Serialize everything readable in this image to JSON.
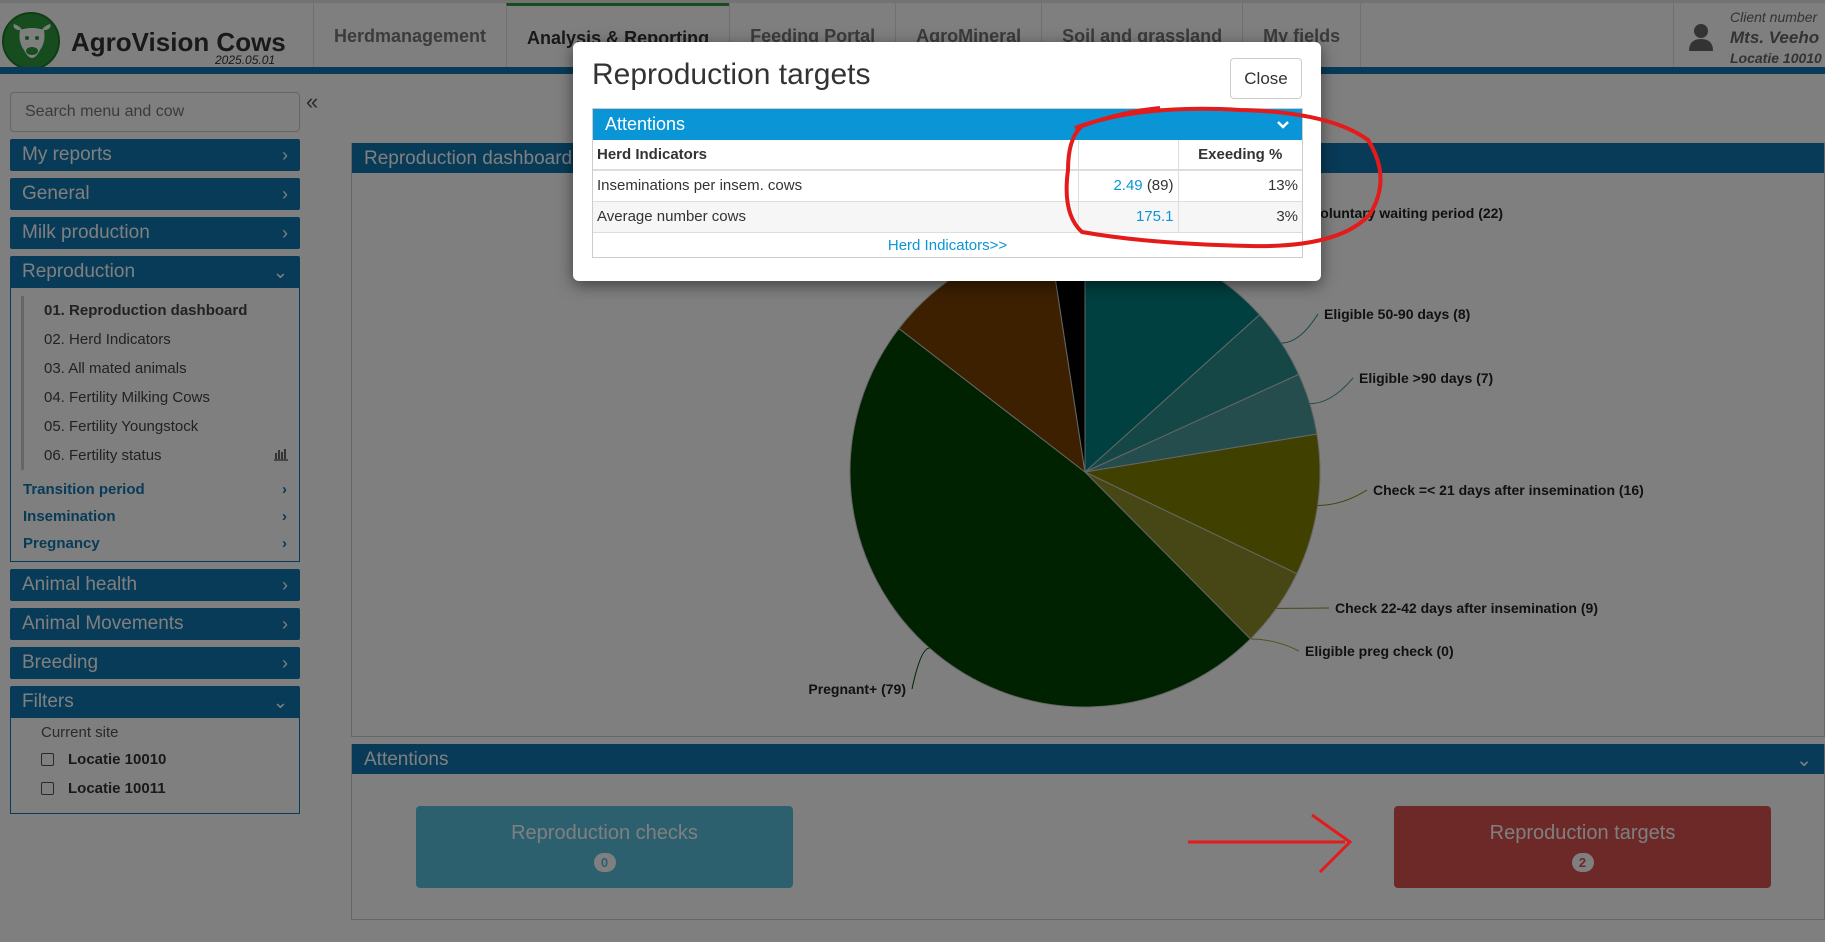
{
  "app": {
    "name": "AgroVision Cows",
    "version": "2025.05.01"
  },
  "nav": {
    "tabs": [
      {
        "label": "Herdmanagement",
        "active": false
      },
      {
        "label": "Analysis & Reporting",
        "active": true
      },
      {
        "label": "Feeding Portal",
        "active": false
      },
      {
        "label": "AgroMineral",
        "active": false
      },
      {
        "label": "Soil and grassland",
        "active": false
      },
      {
        "label": "My fields",
        "active": false
      }
    ]
  },
  "user": {
    "client_label": "Client number",
    "name": "Mts. Veeho",
    "location": "Locatie 10010"
  },
  "sidebar": {
    "search_placeholder": "Search menu and cow",
    "sections": {
      "my_reports": "My reports",
      "general": "General",
      "milk_production": "Milk production",
      "reproduction": "Reproduction",
      "animal_health": "Animal health",
      "animal_movements": "Animal Movements",
      "breeding": "Breeding",
      "filters": "Filters"
    },
    "reproduction_items": [
      "01. Reproduction dashboard",
      "02. Herd Indicators",
      "03. All mated animals",
      "04. Fertility Milking Cows",
      "05. Fertility Youngstock",
      "06. Fertility status"
    ],
    "reproduction_groups": [
      "Transition period",
      "Insemination",
      "Pregnancy"
    ],
    "filters": {
      "label": "Current site",
      "options": [
        "Locatie 10010",
        "Locatie 10011"
      ]
    }
  },
  "dashboard": {
    "title": "Reproduction dashboard"
  },
  "chart_data": {
    "type": "pie",
    "slices": [
      {
        "label": "Voluntary waiting period (22)",
        "value": 22,
        "color": "#008080"
      },
      {
        "label": "Eligible 50-90 days (8)",
        "value": 8,
        "color": "#2b8f8f"
      },
      {
        "label": "Eligible >90 days (7)",
        "value": 7,
        "color": "#4d9a9a"
      },
      {
        "label": "Check =< 21 days after insemination (16)",
        "value": 16,
        "color": "#808000"
      },
      {
        "label": "Check 22-42 days after insemination (9)",
        "value": 9,
        "color": "#8f8f2c"
      },
      {
        "label": "Eligible preg check (0)",
        "value": 0,
        "color": "#a6a640"
      },
      {
        "label": "Pregnant+ (79)",
        "value": 79,
        "color": "#004400"
      },
      {
        "label": "",
        "value": 20,
        "color": "#7a4000"
      },
      {
        "label": "",
        "value": 4,
        "color": "#000000"
      }
    ]
  },
  "attentions": {
    "title": "Attentions",
    "buttons": [
      {
        "label": "Reproduction checks",
        "count": "0"
      },
      {
        "label": "Reproduction targets",
        "count": "2"
      }
    ]
  },
  "modal": {
    "title": "Reproduction targets",
    "close_label": "Close",
    "panel_title": "Attentions",
    "table": {
      "headers": [
        "Herd Indicators",
        "",
        "Exeeding %"
      ],
      "rows": [
        {
          "name": "Inseminations per insem. cows",
          "value": "2.49",
          "extra": "(89)",
          "exceeding": "13%"
        },
        {
          "name": "Average number cows",
          "value": "175.1",
          "extra": "",
          "exceeding": "3%"
        }
      ]
    },
    "link": "Herd Indicators>>"
  },
  "colors": {
    "primary": "#1076b0",
    "modal_header": "#0a95d6",
    "danger": "#d9534f",
    "info": "#5bc0de",
    "annotation": "#e31b1b"
  }
}
